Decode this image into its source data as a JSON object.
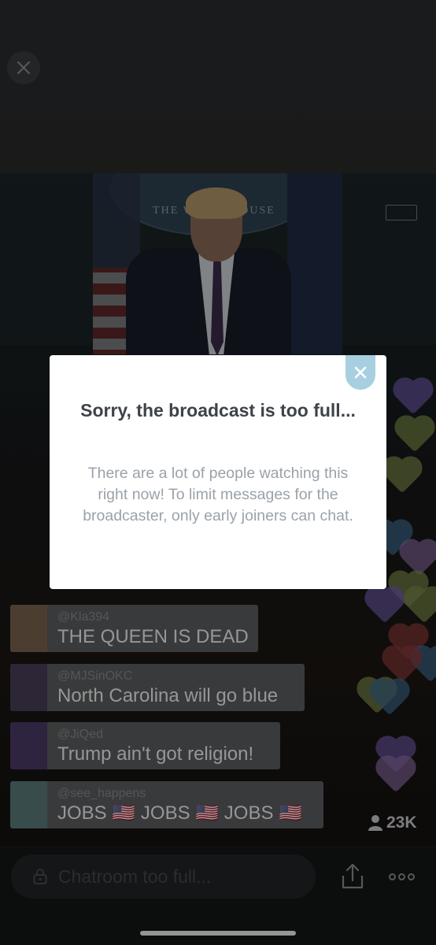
{
  "video": {
    "seal_text": "THE WHITE HOUSE"
  },
  "chat": {
    "messages": [
      {
        "user": "@Kla394",
        "text": "THE QUEEN IS DEAD",
        "avatar_color": "#7a6450"
      },
      {
        "user": "@MJSinOKC",
        "text": "North Carolina will go blue",
        "avatar_color": "#4a3e5a"
      },
      {
        "user": "@JiQed",
        "text": "Trump ain't got religion!",
        "avatar_color": "#4b3a66"
      },
      {
        "user": "@see_happens",
        "text": "JOBS 🇺🇸 JOBS 🇺🇸 JOBS 🇺🇸",
        "avatar_color": "#5b7b7a"
      }
    ]
  },
  "viewer_count": "23K",
  "chat_input": {
    "placeholder": "Chatroom too full..."
  },
  "modal": {
    "title": "Sorry, the broadcast is too full...",
    "body": "There are a lot of people watching this right now! To limit messages for the broadcaster, only early joiners can chat."
  },
  "icons": {
    "close": "close-icon",
    "modal_close": "close-icon",
    "lock": "lock-icon",
    "share": "share-icon",
    "more": "more-icon",
    "viewers": "person-icon"
  },
  "colors": {
    "modal_close_bg": "#a8cfe0",
    "heart_colors": [
      "#6f5aa8",
      "#7c8c4a",
      "#3f6b8f",
      "#8c3a3a",
      "#8a6aa0"
    ]
  }
}
